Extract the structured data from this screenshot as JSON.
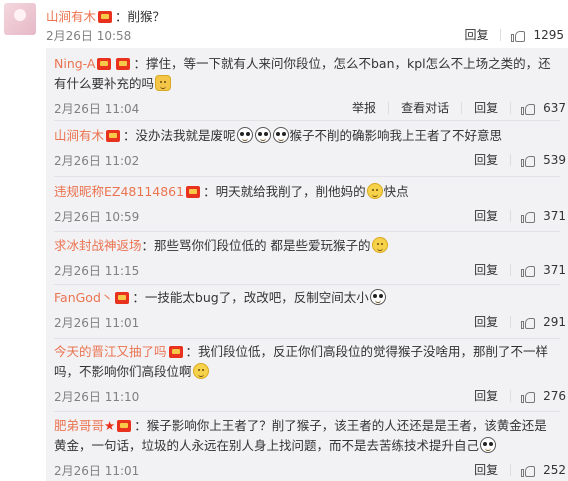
{
  "top_comment": {
    "user": "山涧有木",
    "text": "：削猴？",
    "time": "2月26日 10:58",
    "reply_label": "回复",
    "likes": "1295"
  },
  "replies": [
    {
      "user": "Ning-A",
      "text_a": "：撑住，等一下就有人来问你段位，怎么不ban，kpl怎么不上场之类的，还有什",
      "text_b": "么要补充的吗",
      "time": "2月26日 11:04",
      "report_label": "举报",
      "conversation_label": "查看对话",
      "reply_label": "回复",
      "likes": "637"
    },
    {
      "user": "山涧有木",
      "text_a": "：没办法我就是废呢",
      "text_b": "猴子不削的确影响我上王者了不好意思",
      "time": "2月26日 11:02",
      "reply_label": "回复",
      "likes": "539"
    },
    {
      "user": "违规昵称EZ48114861",
      "text_a": "：明天就给我削了，削他妈的",
      "text_b": "快点",
      "time": "2月26日 10:59",
      "reply_label": "回复",
      "likes": "371"
    },
    {
      "user": "求冰封战神返场",
      "text_a": "：那些骂你们段位低的 都是些爱玩猴子的",
      "time": "2月26日 11:15",
      "reply_label": "回复",
      "likes": "371"
    },
    {
      "user": "FanGod丶",
      "text_a": "：一技能太bug了，改改吧，反制空间太小",
      "time": "2月26日 11:01",
      "reply_label": "回复",
      "likes": "291"
    },
    {
      "user": "今天的晋江又抽了吗",
      "text_a": "：我们段位低，反正你们高段位的觉得猴子没啥用，那削了不一样吗，",
      "text_b": "不影响你们高段位啊",
      "time": "2月26日 11:10",
      "reply_label": "回复",
      "likes": "276"
    },
    {
      "user": "肥弟哥哥",
      "text_a": "：猴子影响你上王者了？削了猴子，该王者的人还还是是王者，该黄金还是黄",
      "text_b": "金，一句话，垃圾的人永远在别人身上找问题，而不是去苦练技术提升自己",
      "time": "2月26日 11:01",
      "reply_label": "回复",
      "likes": "252"
    }
  ]
}
